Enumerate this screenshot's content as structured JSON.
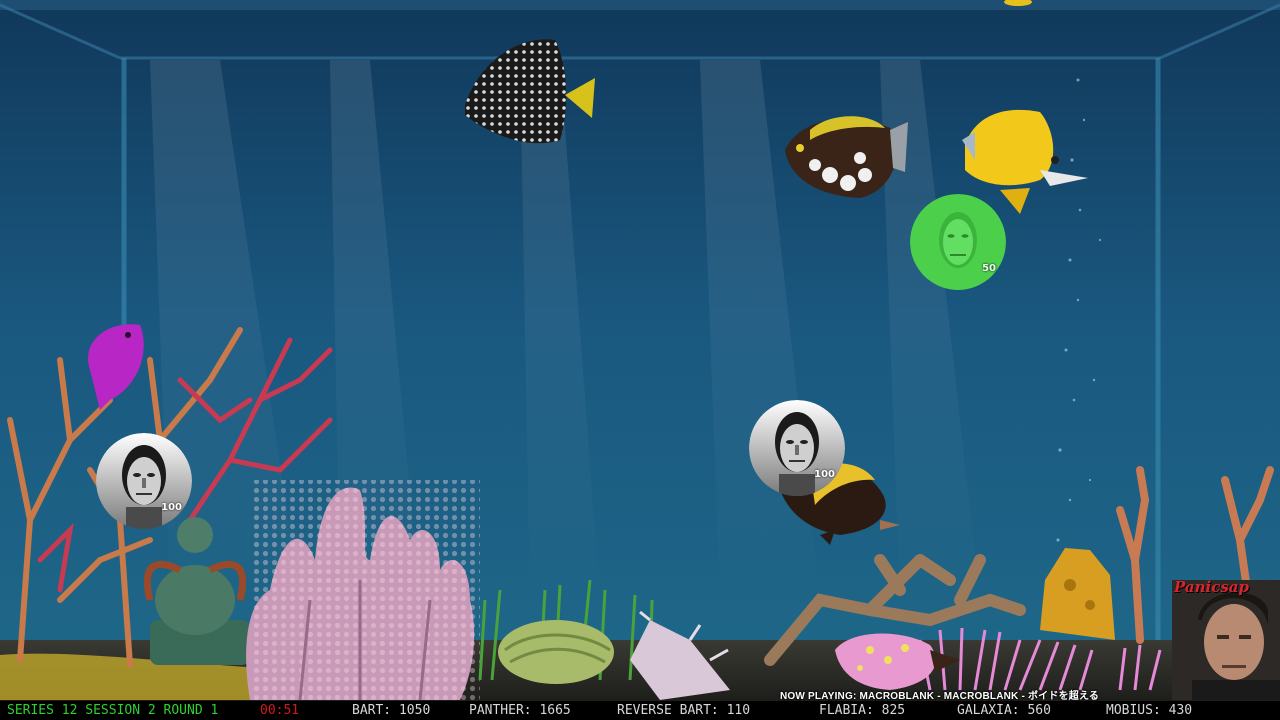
{
  "hud": {
    "series_label": "SERIES 12 SESSION 2 ROUND 1",
    "timer": "00:51",
    "scores": [
      {
        "name": "BART",
        "score": "1050",
        "text": "BART: 1050"
      },
      {
        "name": "PANTHER",
        "score": "1665",
        "text": "PANTHER: 1665"
      },
      {
        "name": "REVERSE BART",
        "score": "110",
        "text": "REVERSE BART: 110"
      },
      {
        "name": "FLABIA",
        "score": "825",
        "text": "FLABIA: 825"
      },
      {
        "name": "GALAXIA",
        "score": "560",
        "text": "GALAXIA: 560"
      },
      {
        "name": "MOBIUS",
        "score": "430",
        "text": "MOBIUS: 430"
      }
    ],
    "now_playing": "NOW PLAYING: MACROBLANK - MACROBLANK - ボイドを超える"
  },
  "tokens": [
    {
      "id": "token-left",
      "value": "100",
      "color": "#e8e8e8"
    },
    {
      "id": "token-mid",
      "value": "100",
      "color": "#e8e8e8"
    },
    {
      "id": "token-green",
      "value": "50",
      "color": "#4cd04c"
    }
  ],
  "webcam": {
    "logo_text": "Panicsap"
  },
  "colors": {
    "water": "#1d5a84",
    "series_text": "#2fd12f",
    "timer_text": "#d11a1a",
    "score_text": "#d8d8d8",
    "bar_bg": "#000000"
  }
}
